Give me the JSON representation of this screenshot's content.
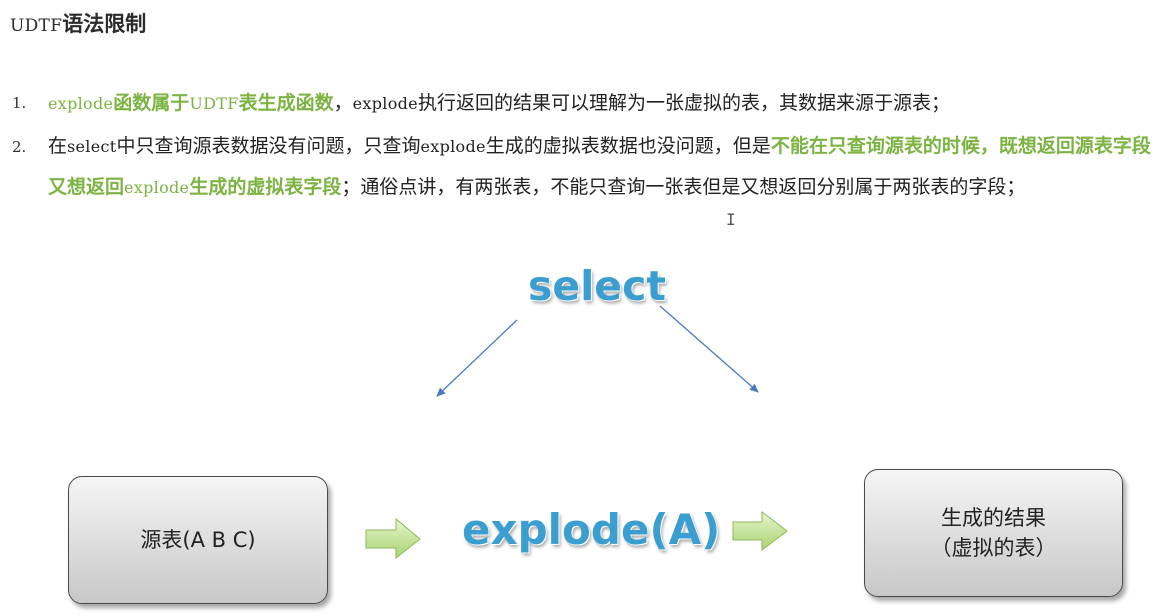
{
  "title": {
    "code": "UDTF",
    "text": "语法限制"
  },
  "rules": [
    {
      "number": "1.",
      "p1": "explode",
      "p2": "函数属于",
      "p3": "UDTF",
      "p4": "表生成函数",
      "p5": "，",
      "p6": "explode",
      "p7": "执行返回的结果可以理解为一张虚拟的表，其数据来源于源表；"
    },
    {
      "number": "2.",
      "p1": "在",
      "p2": "select",
      "p3": "中只查询源表数据没有问题，只查询",
      "p4": "explode",
      "p5": "生成的虚拟表数据也没问题，但是",
      "p6": "不能在只查询源表的时候，既想返回源表字段又想返回",
      "p7": "explode",
      "p8": "生成的虚拟表字段",
      "p9": "；通俗点讲，有两张表，不能只查询一张表但是又想返回分别属于两张表的字段；"
    }
  ],
  "diagram": {
    "select_label": "select",
    "source_box": "源表(A B C)",
    "explode_label": "explode(A)",
    "result_line1": "生成的结果",
    "result_line2": "（虚拟的表）"
  },
  "colors": {
    "accent_green": "#7cb342",
    "wordart_blue": "#3a9ed0",
    "arrow_green": "#c5e39a",
    "line_blue": "#4a78c2"
  },
  "cursor_icon": "text-cursor-icon"
}
